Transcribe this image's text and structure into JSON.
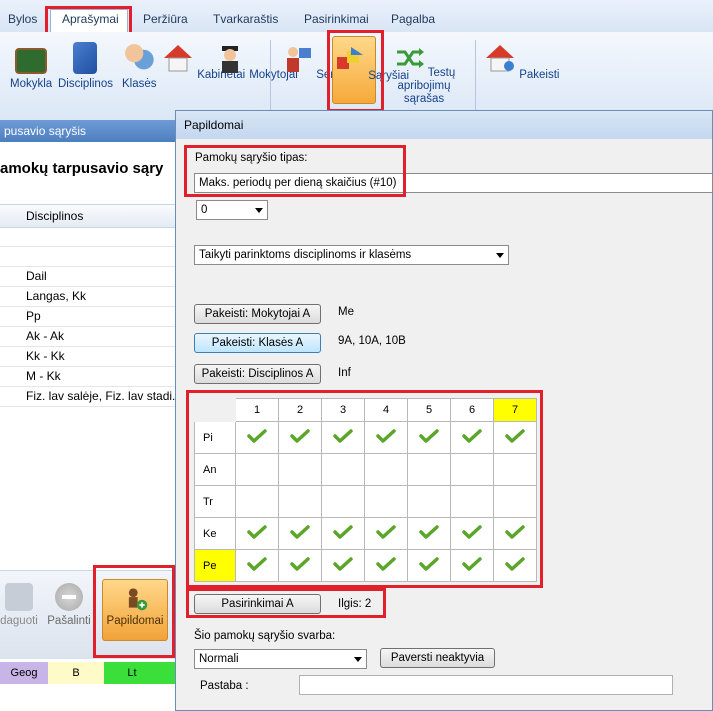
{
  "menubar": {
    "items": [
      "Bylos",
      "Aprašymai",
      "Peržiūra",
      "Tvarkaraštis",
      "Pasirinkimai",
      "Pagalba"
    ]
  },
  "ribbon": {
    "items": [
      "Mokykla",
      "Disciplinos",
      "Klasės",
      "Kabinetai",
      "Mokytojai",
      "Seminarai",
      "Sąryšiai",
      "Testų apribojimų sąrašas",
      "Pakeisti"
    ]
  },
  "left_panel": {
    "title": "pusavio sąryšis",
    "heading": "amokų tarpusavio sąry",
    "column_header": "Disciplinos",
    "rows": [
      "Dail",
      "Langas, Kk",
      "Pp",
      "Ak - Ak",
      "Kk - Kk",
      "M - Kk",
      "Fiz. lav salėje, Fiz. lav stadi..."
    ],
    "buttons": [
      "daguoti",
      "Pašalinti",
      "Papildomai"
    ],
    "status_cells": [
      "Geog",
      "B",
      "Lt"
    ]
  },
  "dialog": {
    "title": "Papildomai",
    "type_label": "Pamokų sąryšio tipas:",
    "type_value": "Maks. periodų per dieną skaičius (#10)",
    "count_value": "0",
    "apply_value": "Taikyti parinktoms disciplinoms ir klasėms",
    "teachers_button": "Pakeisti: Mokytojai A",
    "teachers_value": "Me",
    "classes_button": "Pakeisti: Klasės A",
    "classes_value": "9A, 10A, 10B",
    "subjects_button": "Pakeisti: Disciplinos A",
    "subjects_value": "Inf",
    "grid": {
      "periods": [
        "1",
        "2",
        "3",
        "4",
        "5",
        "6",
        "7"
      ],
      "days": [
        "Pi",
        "An",
        "Tr",
        "Ke",
        "Pe"
      ],
      "checked": [
        [
          1,
          1,
          1,
          1,
          1,
          1,
          1
        ],
        [
          0,
          0,
          0,
          0,
          0,
          0,
          0
        ],
        [
          0,
          0,
          0,
          0,
          0,
          0,
          0
        ],
        [
          1,
          1,
          1,
          1,
          1,
          1,
          1
        ],
        [
          1,
          1,
          1,
          1,
          1,
          1,
          1
        ]
      ],
      "highlight_period": "7",
      "highlight_day": "Pe"
    },
    "choices_button": "Pasirinkimai A",
    "duration_text": "Ilgis: 2",
    "importance_label": "Šio pamokų sąryšio svarba:",
    "importance_value": "Normali",
    "inactive_button": "Paversti neaktyvia",
    "note_label": "Pastaba :",
    "note_value": ""
  },
  "colors": {
    "highlight": "#ffff00",
    "accent": "#e0202a",
    "check": "#5aa52a"
  }
}
